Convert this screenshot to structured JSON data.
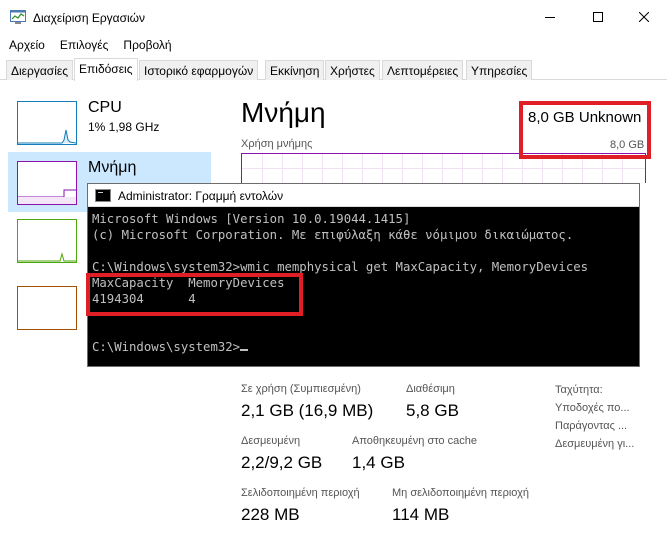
{
  "window": {
    "title": "Διαχείριση Εργασιών"
  },
  "menu": [
    "Αρχείο",
    "Επιλογές",
    "Προβολή"
  ],
  "tabs": [
    "Διεργασίες",
    "Επιδόσεις",
    "Ιστορικό εφαρμογών",
    "Εκκίνηση",
    "Χρήστες",
    "Λεπτομέρειες",
    "Υπηρεσίες"
  ],
  "active_tab": "Επιδόσεις",
  "sidebar": {
    "cpu": {
      "title": "CPU",
      "subtitle": "1% 1,98 GHz"
    },
    "memory": {
      "title": "Μνήμη"
    }
  },
  "memory": {
    "title": "Μνήμη",
    "total": "8,0 GB Unknown",
    "usage_label": "Χρήση μνήμης",
    "usage_max": "8,0 GB"
  },
  "stats": {
    "in_use_label": "Σε χρήση (Συμπιεσμένη)",
    "in_use_value": "2,1 GB (16,9 MB)",
    "available_label": "Διαθέσιμη",
    "available_value": "5,8 GB",
    "committed_label": "Δεσμευμένη",
    "committed_value": "2,2/9,2 GB",
    "cached_label": "Αποθηκευμένη στο cache",
    "cached_value": "1,4 GB",
    "paged_label": "Σελιδοποιημένη περιοχή",
    "paged_value": "228 MB",
    "nonpaged_label": "Μη σελιδοποιημένη περιοχή",
    "nonpaged_value": "114 MB",
    "speed_label": "Ταχύτητα:",
    "slots_label": "Υποδοχές πο...",
    "form_label": "Παράγοντας ...",
    "reserved_label": "Δεσμευμένη γι..."
  },
  "cmd": {
    "title": "Administrator: Γραμμή εντολών",
    "lines": [
      "Microsoft Windows [Version 10.0.19044.1415]",
      "(c) Microsoft Corporation. Με επιφύλαξη κάθε νόμιμου δικαιώματος.",
      "",
      "C:\\Windows\\system32>wmic memphysical get MaxCapacity, MemoryDevices",
      "MaxCapacity  MemoryDevices",
      "4194304      4",
      "",
      "",
      "C:\\Windows\\system32>"
    ]
  },
  "colors": {
    "highlight": "#e01e25",
    "cpu_graph": "#117dbb",
    "memory_graph": "#8b12ae",
    "disk_graph": "#4da60c",
    "ethernet_graph": "#a74f01",
    "selection": "#cce8ff"
  }
}
